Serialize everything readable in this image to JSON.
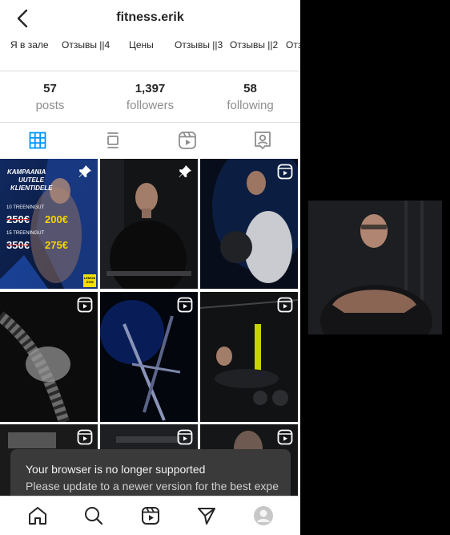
{
  "header": {
    "username": "fitness.erik"
  },
  "highlights": [
    "Я в зале",
    "Отзывы ||4",
    "Цены",
    "Отзывы ||3",
    "Отзывы ||2",
    "Отз"
  ],
  "stats": [
    {
      "value": "57",
      "label": "posts"
    },
    {
      "value": "1,397",
      "label": "followers"
    },
    {
      "value": "58",
      "label": "following"
    }
  ],
  "tabs": [
    "grid-icon",
    "feed-icon",
    "reels-icon",
    "tagged-icon"
  ],
  "promo": {
    "title_line1": "KAMPAANIA",
    "title_line2": "UUTELE",
    "title_line3": "KLIENTIDELE",
    "offer1_label": "10 TREENINGUT",
    "offer1_old": "250€",
    "offer1_new": "200€",
    "offer2_label": "15 TREENINGUT",
    "offer2_old": "350€",
    "offer2_new": "275€",
    "brand": "LEMON GYM"
  },
  "toast": {
    "title": "Your browser is no longer supported",
    "message": "Please update to a newer version for the best expe"
  },
  "nav": [
    "home-icon",
    "search-icon",
    "reels-icon",
    "direct-icon",
    "profile-icon"
  ],
  "colors": {
    "accent": "#0095f6",
    "text": "#262626",
    "muted": "#8e8e8e",
    "border": "#dbdbdb"
  }
}
